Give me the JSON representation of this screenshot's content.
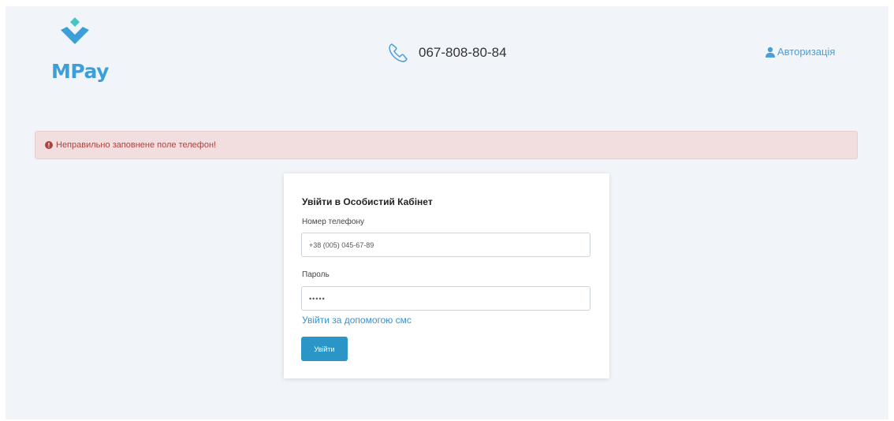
{
  "header": {
    "logo_text": "MPay",
    "phone_number": "067-808-80-84",
    "auth_label": "Авторизація"
  },
  "alert": {
    "message": "Неправильно заповнене поле телефон!"
  },
  "login_form": {
    "title": "Увійти в Особистий Кабінет",
    "phone_label": "Номер телефону",
    "phone_value": "+38 (005) 045-67-89",
    "password_label": "Пароль",
    "password_value": "•••••",
    "sms_link": "Увійти за допомогою смс",
    "submit_label": "Увійти"
  },
  "colors": {
    "brand": "#3d9fd8",
    "button": "#2b95c8",
    "alert_bg": "#f2dede",
    "alert_text": "#a94442",
    "page_bg": "#f1f5fa"
  }
}
